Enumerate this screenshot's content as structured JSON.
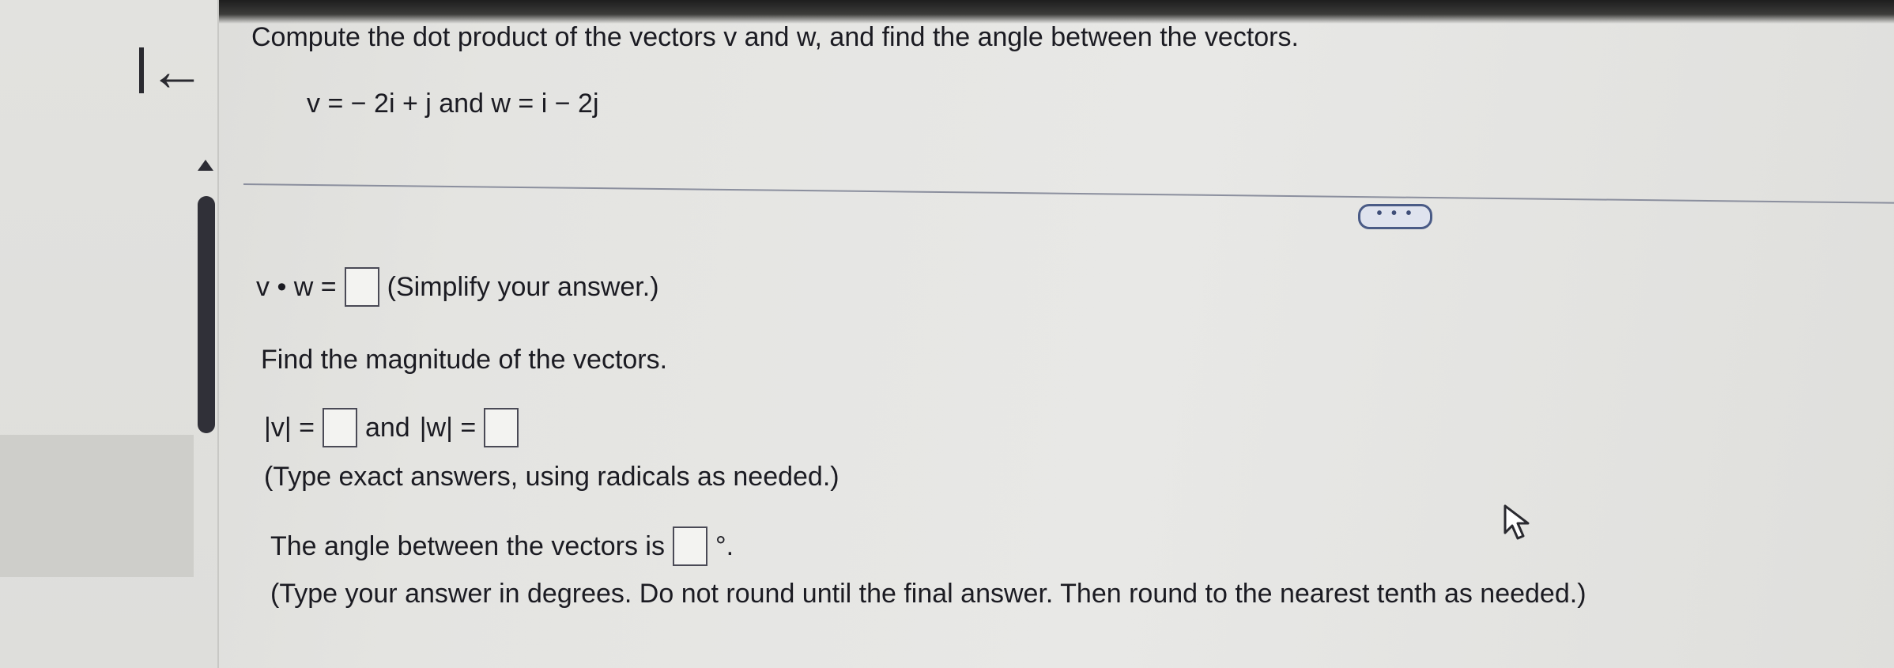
{
  "question": {
    "prompt": "Compute the dot product of the vectors v and w, and find the angle between the vectors.",
    "vectors": "v = − 2i + j and w = i − 2j"
  },
  "more_button": {
    "label": "• • •"
  },
  "dot_product": {
    "label": "v • w =",
    "hint": "(Simplify your answer.)"
  },
  "magnitude": {
    "heading": "Find the magnitude of the vectors.",
    "v_label": "|v| =",
    "and_label": "and",
    "w_label": "|w| =",
    "hint": "(Type exact answers, using radicals as needed.)"
  },
  "angle": {
    "label": "The angle between the vectors is",
    "unit": "°.",
    "hint": "(Type your answer in degrees. Do not round until the final answer. Then round to the nearest tenth as needed.)"
  },
  "icons": {
    "back": "collapse-left-icon",
    "scroll": "scroll-up-icon",
    "pointer": "mouse-pointer-icon"
  }
}
